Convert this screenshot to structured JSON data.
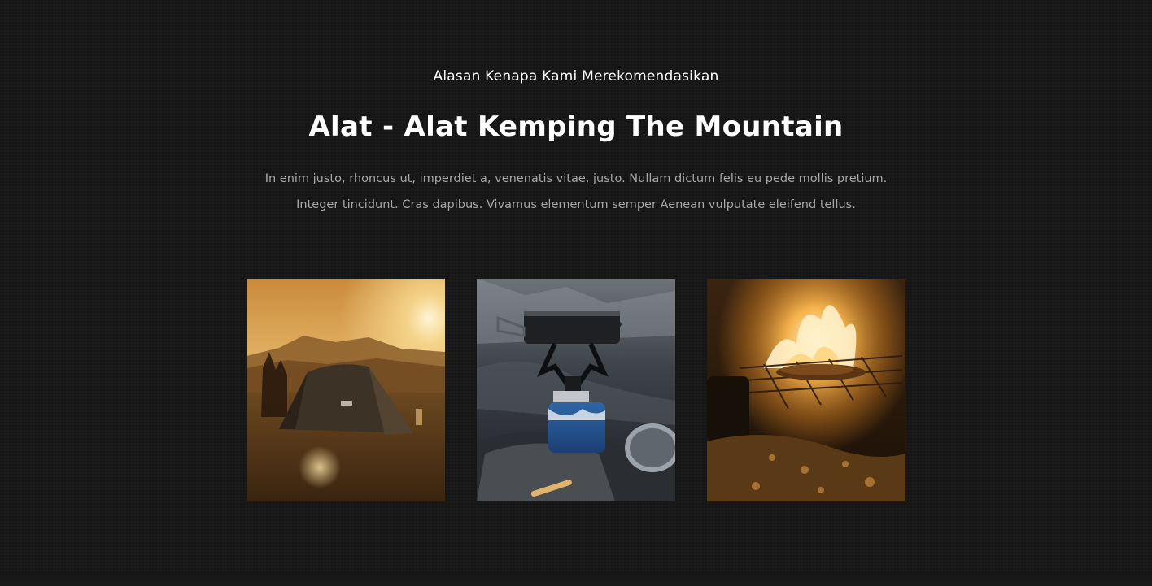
{
  "section": {
    "subtitle": "Alasan Kenapa Kami Merekomendasikan",
    "title": "Alat - Alat Kemping The Mountain",
    "description": "In enim justo, rhoncus ut, imperdiet a, venenatis vitae, justo. Nullam dictum felis eu pede mollis pretium. Integer tincidunt. Cras dapibus. Vivamus elementum semper Aenean vulputate eleifend tellus."
  },
  "gallery": [
    {
      "subject": "tent-at-sunset-photo"
    },
    {
      "subject": "camping-stove-photo"
    },
    {
      "subject": "campfire-grill-photo"
    }
  ],
  "colors": {
    "background": "#161616",
    "heading": "#ffffff",
    "body_text": "#a7a7a7"
  }
}
